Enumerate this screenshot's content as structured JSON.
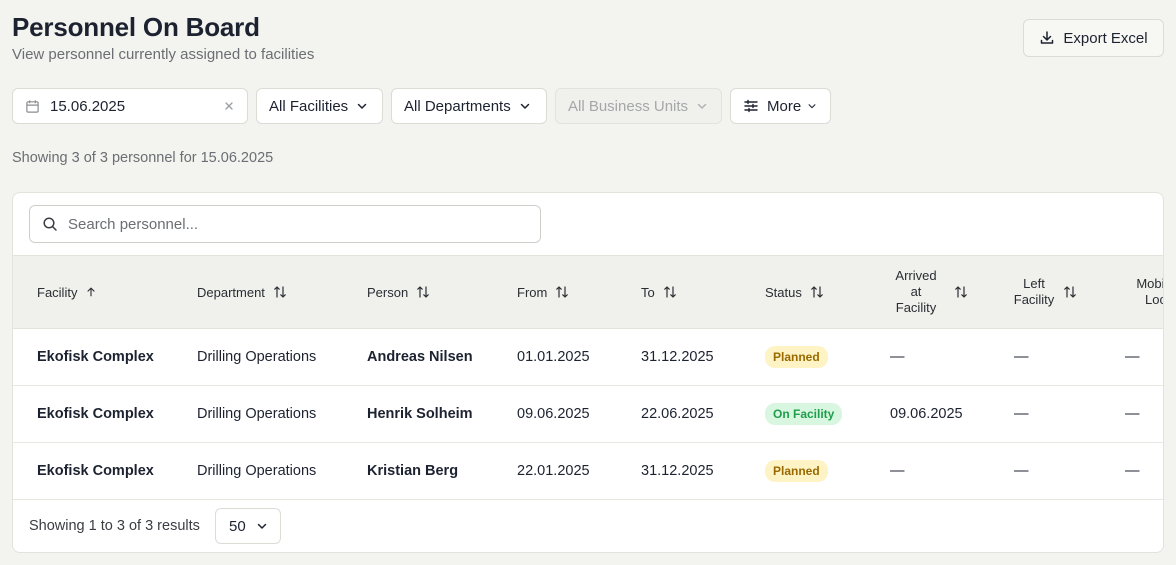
{
  "header": {
    "title": "Personnel On Board",
    "subtitle": "View personnel currently assigned to facilities",
    "export_label": "Export Excel"
  },
  "filters": {
    "date": "15.06.2025",
    "facilities": "All Facilities",
    "departments": "All Departments",
    "business_units": "All Business Units",
    "more": "More"
  },
  "summary": "Showing 3 of 3 personnel for 15.06.2025",
  "search": {
    "placeholder": "Search personnel..."
  },
  "table": {
    "columns": {
      "facility": "Facility",
      "department": "Department",
      "person": "Person",
      "from": "From",
      "to": "To",
      "status": "Status",
      "arrived_1": "Arrived",
      "arrived_2": "at",
      "arrived_3": "Facility",
      "left_1": "Left",
      "left_2": "Facility",
      "mobiliz_1": "Mobiliz",
      "mobiliz_2": "Locat"
    },
    "rows": [
      {
        "facility": "Ekofisk Complex",
        "department": "Drilling Operations",
        "person": "Andreas Nilsen",
        "from": "01.01.2025",
        "to": "31.12.2025",
        "status": "Planned",
        "arrived": "—",
        "left": "—",
        "mobilization": "—"
      },
      {
        "facility": "Ekofisk Complex",
        "department": "Drilling Operations",
        "person": "Henrik Solheim",
        "from": "09.06.2025",
        "to": "22.06.2025",
        "status": "On Facility",
        "arrived": "09.06.2025",
        "left": "—",
        "mobilization": "—"
      },
      {
        "facility": "Ekofisk Complex",
        "department": "Drilling Operations",
        "person": "Kristian Berg",
        "from": "22.01.2025",
        "to": "31.12.2025",
        "status": "Planned",
        "arrived": "—",
        "left": "—",
        "mobilization": "—"
      }
    ]
  },
  "footer": {
    "results": "Showing 1 to 3 of 3 results",
    "page_size": "50"
  },
  "colors": {
    "planned_bg": "#fdf3c4",
    "planned_text": "#9a6a00",
    "on_facility_bg": "#d9f6e1",
    "on_facility_text": "#1e9e4a"
  }
}
